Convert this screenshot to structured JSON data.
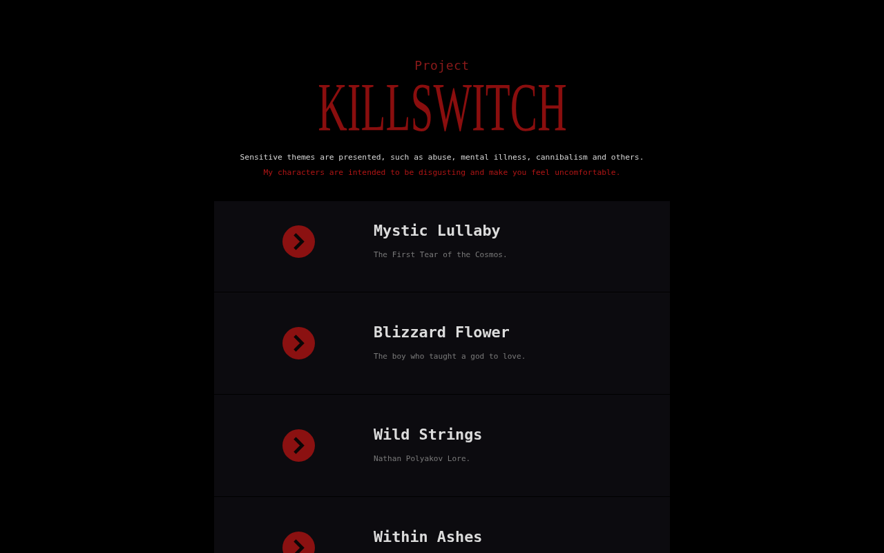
{
  "header": {
    "kicker": "Project",
    "title": "KILLSWITCH",
    "notice": "Sensitive themes are presented, such as abuse, mental illness, cannibalism and others.",
    "warning": "My characters are intended to be disgusting and make you feel uncomfortable."
  },
  "stories": [
    {
      "title": "Mystic Lullaby",
      "subtitle": "The First Tear of the Cosmos."
    },
    {
      "title": "Blizzard Flower",
      "subtitle": "The boy who taught a god to love."
    },
    {
      "title": "Wild Strings",
      "subtitle": "Nathan Polyakov Lore."
    },
    {
      "title": "Within Ashes"
    }
  ]
}
